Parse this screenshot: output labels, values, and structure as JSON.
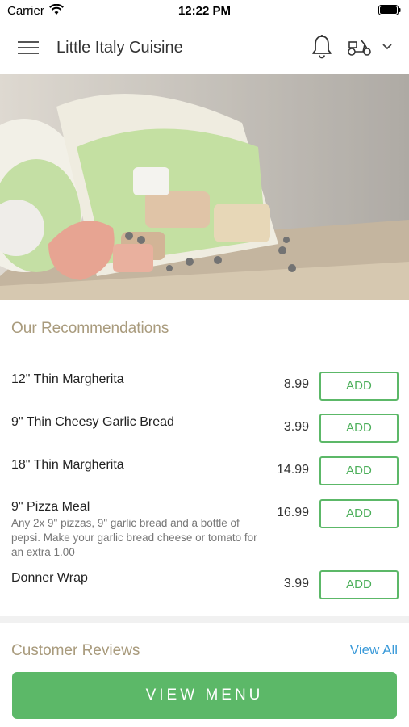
{
  "status_bar": {
    "carrier": "Carrier",
    "time": "12:22 PM"
  },
  "header": {
    "title": "Little Italy Cuisine"
  },
  "recommendations": {
    "title": "Our Recommendations",
    "add_label": "ADD",
    "items": [
      {
        "name": "12\" Thin Margherita",
        "price": "8.99",
        "description": ""
      },
      {
        "name": "9\" Thin Cheesy Garlic Bread",
        "price": "3.99",
        "description": ""
      },
      {
        "name": "18\" Thin Margherita",
        "price": "14.99",
        "description": ""
      },
      {
        "name": "9\" Pizza Meal",
        "price": "16.99",
        "description": "Any 2x 9\" pizzas, 9\" garlic bread and a bottle of pepsi. Make your garlic bread cheese or tomato for an extra 1.00"
      },
      {
        "name": "Donner Wrap",
        "price": "3.99",
        "description": ""
      }
    ]
  },
  "reviews": {
    "title": "Customer Reviews",
    "view_all": "View All"
  },
  "footer": {
    "view_menu": "VIEW MENU"
  },
  "colors": {
    "accent_green": "#5cb868",
    "section_gold": "#a99b7d",
    "link_blue": "#3a9ad9"
  }
}
